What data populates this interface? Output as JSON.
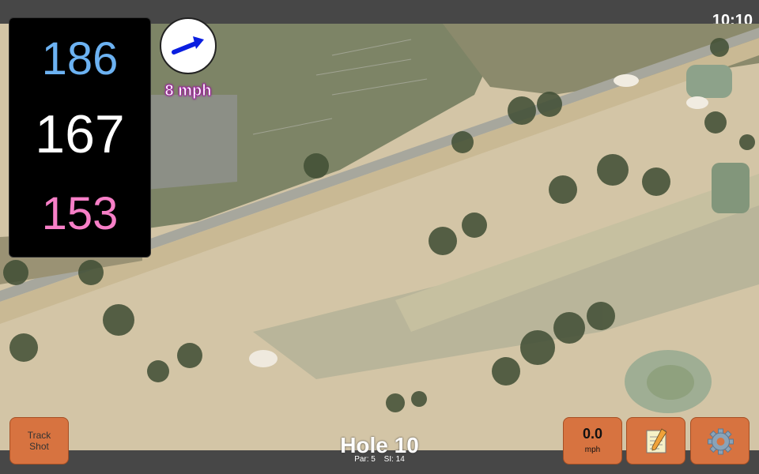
{
  "status": {
    "time": "10:10"
  },
  "distances": {
    "back": "186",
    "center": "167",
    "front": "153"
  },
  "wind": {
    "speed_label": "8 mph",
    "icon": "wind-direction-arrow-icon"
  },
  "hole": {
    "title": "Hole 10",
    "par_label": "Par: 5",
    "si_label": "SI: 14"
  },
  "buttons": {
    "track_line1": "Track",
    "track_line2": "Shot",
    "speed_value": "0.0",
    "speed_unit": "mph",
    "notes_icon": "notepad-icon",
    "settings_icon": "gear-icon"
  },
  "colors": {
    "back": "#6cb2f2",
    "center": "#ffffff",
    "front": "#f77fc7",
    "button": "#d77340",
    "wind_arrow": "#0a1ee0"
  }
}
